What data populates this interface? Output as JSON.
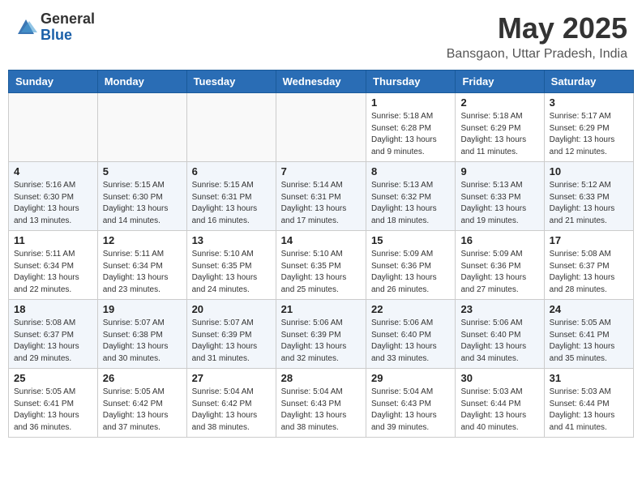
{
  "header": {
    "logo_general": "General",
    "logo_blue": "Blue",
    "month_title": "May 2025",
    "location": "Bansgaon, Uttar Pradesh, India"
  },
  "weekdays": [
    "Sunday",
    "Monday",
    "Tuesday",
    "Wednesday",
    "Thursday",
    "Friday",
    "Saturday"
  ],
  "weeks": [
    [
      {
        "day": "",
        "info": ""
      },
      {
        "day": "",
        "info": ""
      },
      {
        "day": "",
        "info": ""
      },
      {
        "day": "",
        "info": ""
      },
      {
        "day": "1",
        "info": "Sunrise: 5:18 AM\nSunset: 6:28 PM\nDaylight: 13 hours\nand 9 minutes."
      },
      {
        "day": "2",
        "info": "Sunrise: 5:18 AM\nSunset: 6:29 PM\nDaylight: 13 hours\nand 11 minutes."
      },
      {
        "day": "3",
        "info": "Sunrise: 5:17 AM\nSunset: 6:29 PM\nDaylight: 13 hours\nand 12 minutes."
      }
    ],
    [
      {
        "day": "4",
        "info": "Sunrise: 5:16 AM\nSunset: 6:30 PM\nDaylight: 13 hours\nand 13 minutes."
      },
      {
        "day": "5",
        "info": "Sunrise: 5:15 AM\nSunset: 6:30 PM\nDaylight: 13 hours\nand 14 minutes."
      },
      {
        "day": "6",
        "info": "Sunrise: 5:15 AM\nSunset: 6:31 PM\nDaylight: 13 hours\nand 16 minutes."
      },
      {
        "day": "7",
        "info": "Sunrise: 5:14 AM\nSunset: 6:31 PM\nDaylight: 13 hours\nand 17 minutes."
      },
      {
        "day": "8",
        "info": "Sunrise: 5:13 AM\nSunset: 6:32 PM\nDaylight: 13 hours\nand 18 minutes."
      },
      {
        "day": "9",
        "info": "Sunrise: 5:13 AM\nSunset: 6:33 PM\nDaylight: 13 hours\nand 19 minutes."
      },
      {
        "day": "10",
        "info": "Sunrise: 5:12 AM\nSunset: 6:33 PM\nDaylight: 13 hours\nand 21 minutes."
      }
    ],
    [
      {
        "day": "11",
        "info": "Sunrise: 5:11 AM\nSunset: 6:34 PM\nDaylight: 13 hours\nand 22 minutes."
      },
      {
        "day": "12",
        "info": "Sunrise: 5:11 AM\nSunset: 6:34 PM\nDaylight: 13 hours\nand 23 minutes."
      },
      {
        "day": "13",
        "info": "Sunrise: 5:10 AM\nSunset: 6:35 PM\nDaylight: 13 hours\nand 24 minutes."
      },
      {
        "day": "14",
        "info": "Sunrise: 5:10 AM\nSunset: 6:35 PM\nDaylight: 13 hours\nand 25 minutes."
      },
      {
        "day": "15",
        "info": "Sunrise: 5:09 AM\nSunset: 6:36 PM\nDaylight: 13 hours\nand 26 minutes."
      },
      {
        "day": "16",
        "info": "Sunrise: 5:09 AM\nSunset: 6:36 PM\nDaylight: 13 hours\nand 27 minutes."
      },
      {
        "day": "17",
        "info": "Sunrise: 5:08 AM\nSunset: 6:37 PM\nDaylight: 13 hours\nand 28 minutes."
      }
    ],
    [
      {
        "day": "18",
        "info": "Sunrise: 5:08 AM\nSunset: 6:37 PM\nDaylight: 13 hours\nand 29 minutes."
      },
      {
        "day": "19",
        "info": "Sunrise: 5:07 AM\nSunset: 6:38 PM\nDaylight: 13 hours\nand 30 minutes."
      },
      {
        "day": "20",
        "info": "Sunrise: 5:07 AM\nSunset: 6:39 PM\nDaylight: 13 hours\nand 31 minutes."
      },
      {
        "day": "21",
        "info": "Sunrise: 5:06 AM\nSunset: 6:39 PM\nDaylight: 13 hours\nand 32 minutes."
      },
      {
        "day": "22",
        "info": "Sunrise: 5:06 AM\nSunset: 6:40 PM\nDaylight: 13 hours\nand 33 minutes."
      },
      {
        "day": "23",
        "info": "Sunrise: 5:06 AM\nSunset: 6:40 PM\nDaylight: 13 hours\nand 34 minutes."
      },
      {
        "day": "24",
        "info": "Sunrise: 5:05 AM\nSunset: 6:41 PM\nDaylight: 13 hours\nand 35 minutes."
      }
    ],
    [
      {
        "day": "25",
        "info": "Sunrise: 5:05 AM\nSunset: 6:41 PM\nDaylight: 13 hours\nand 36 minutes."
      },
      {
        "day": "26",
        "info": "Sunrise: 5:05 AM\nSunset: 6:42 PM\nDaylight: 13 hours\nand 37 minutes."
      },
      {
        "day": "27",
        "info": "Sunrise: 5:04 AM\nSunset: 6:42 PM\nDaylight: 13 hours\nand 38 minutes."
      },
      {
        "day": "28",
        "info": "Sunrise: 5:04 AM\nSunset: 6:43 PM\nDaylight: 13 hours\nand 38 minutes."
      },
      {
        "day": "29",
        "info": "Sunrise: 5:04 AM\nSunset: 6:43 PM\nDaylight: 13 hours\nand 39 minutes."
      },
      {
        "day": "30",
        "info": "Sunrise: 5:03 AM\nSunset: 6:44 PM\nDaylight: 13 hours\nand 40 minutes."
      },
      {
        "day": "31",
        "info": "Sunrise: 5:03 AM\nSunset: 6:44 PM\nDaylight: 13 hours\nand 41 minutes."
      }
    ]
  ]
}
